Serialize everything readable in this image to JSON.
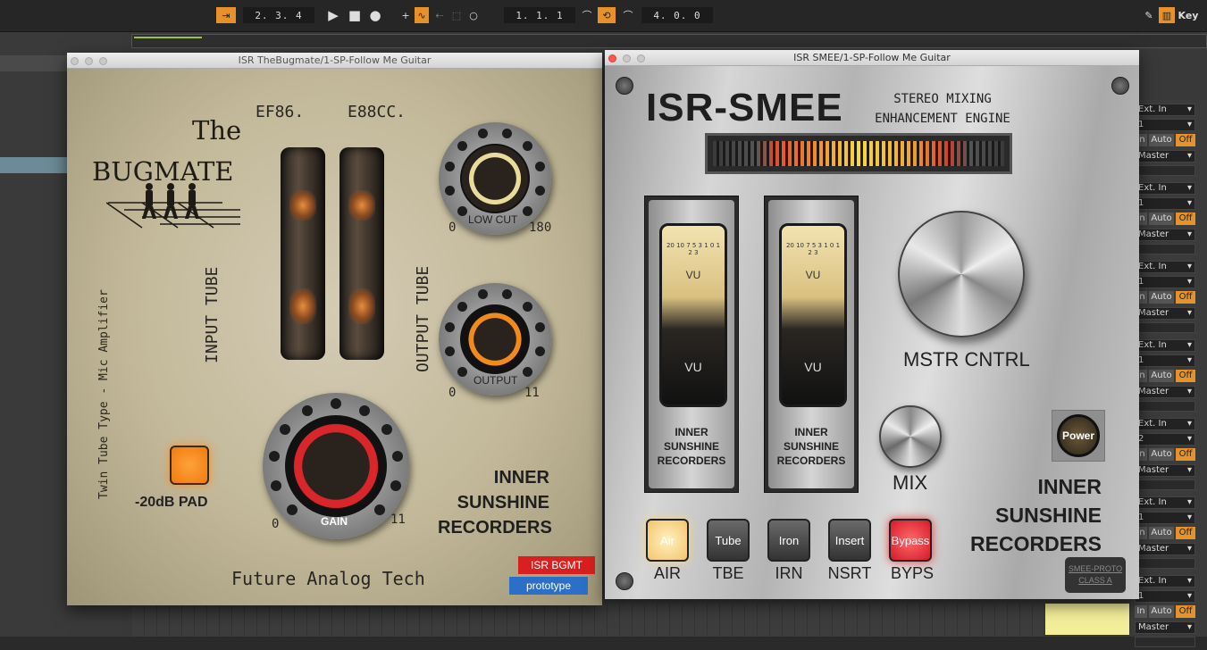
{
  "toolbar": {
    "loop_length": "2. 3. 4",
    "position": "1. 1. 1",
    "punch_out": "4. 0. 0",
    "key_label": "Key"
  },
  "tracks": [
    {
      "input": "Ext. In",
      "channel": "1",
      "in": "In",
      "auto": "Auto",
      "off": "Off",
      "output": "Master"
    },
    {
      "input": "Ext. In",
      "channel": "1",
      "in": "In",
      "auto": "Auto",
      "off": "Off",
      "output": "Master"
    },
    {
      "input": "Ext. In",
      "channel": "1",
      "in": "In",
      "auto": "Auto",
      "off": "Off",
      "output": "Master"
    },
    {
      "input": "Ext. In",
      "channel": "1",
      "in": "In",
      "auto": "Auto",
      "off": "Off",
      "output": "Master"
    },
    {
      "input": "Ext. In",
      "channel": "2",
      "in": "In",
      "auto": "Auto",
      "off": "Off",
      "output": "Master"
    },
    {
      "input": "Ext. In",
      "channel": "1",
      "in": "In",
      "auto": "Auto",
      "off": "Off",
      "output": "Master"
    },
    {
      "input": "Ext. In",
      "channel": "1",
      "in": "In",
      "auto": "Auto",
      "off": "Off",
      "output": "Master"
    }
  ],
  "bugmate": {
    "window_title": "ISR TheBugmate/1-SP-Follow Me Guitar",
    "the": "The",
    "brand": "BUGMATE",
    "tube_left_label": "EF86.",
    "tube_right_label": "E88CC.",
    "input_tube": "INPUT TUBE",
    "output_tube": "OUTPUT TUBE",
    "side_text": "Twin Tube Type - Mic Amplifier",
    "low_cut": {
      "label": "LOW CUT",
      "min": "0",
      "max": "180"
    },
    "output": {
      "label": "OUTPUT",
      "min": "0",
      "max": "11"
    },
    "gain": {
      "label": "GAIN",
      "min": "0",
      "max": "11"
    },
    "pad_label": "-20dB PAD",
    "maker_line1": "INNER",
    "maker_line2": "SUNSHINE",
    "maker_line3": "RECORDERS",
    "footer": "Future Analog Tech",
    "badge_top": "ISR BGMT",
    "badge_bottom": "prototype"
  },
  "smee": {
    "window_title": "ISR SMEE/1-SP-Follow Me Guitar",
    "logo": "ISR-SMEE",
    "subtitle_line1": "STEREO MIXING",
    "subtitle_line2": "ENHANCEMENT ENGINE",
    "vu_scale": "20 10 7 5 3 1 0 1 2 3",
    "vu_face": "VU",
    "vu_bottom": "VU",
    "vu_maker1": "INNER",
    "vu_maker2": "SUNSHINE",
    "vu_maker3": "RECORDERS",
    "master_label": "MSTR CNTRL",
    "mix_label": "MIX",
    "power_label": "Power",
    "buttons": [
      {
        "label": "Air",
        "caption": "AIR"
      },
      {
        "label": "Tube",
        "caption": "TBE"
      },
      {
        "label": "Iron",
        "caption": "IRN"
      },
      {
        "label": "Insert",
        "caption": "NSRT"
      },
      {
        "label": "Bypass",
        "caption": "BYPS"
      }
    ],
    "maker_line1": "INNER",
    "maker_line2": "SUNSHINE",
    "maker_line3": "RECORDERS",
    "proto_line1": "SMEE-PROTO",
    "proto_line2": "CLASS A"
  }
}
